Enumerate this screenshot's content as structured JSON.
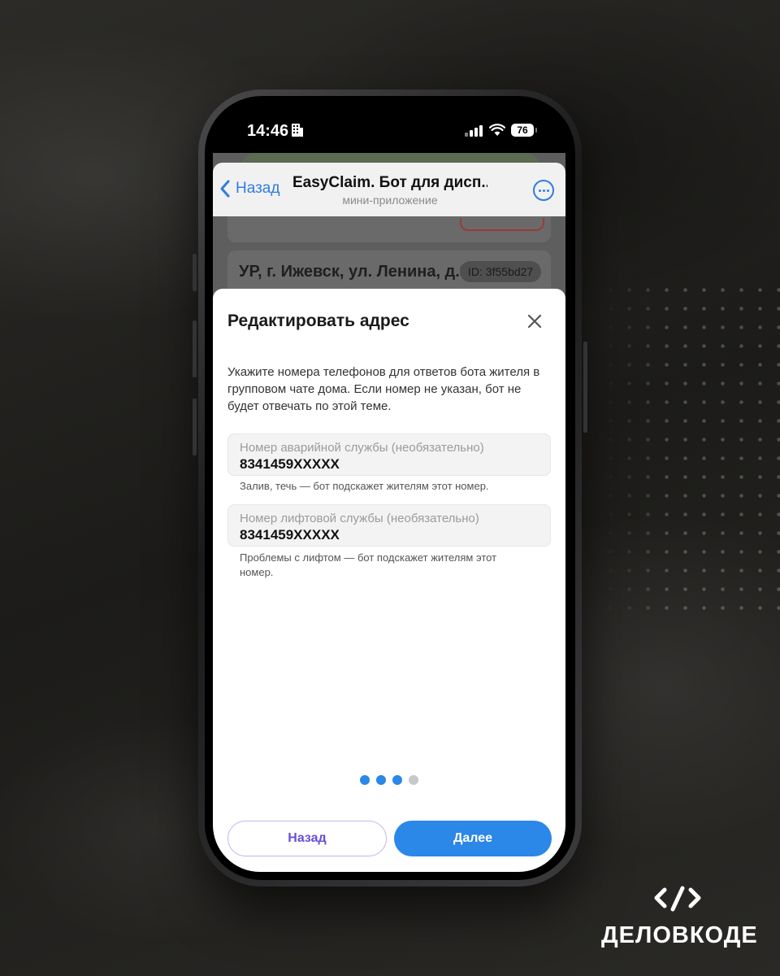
{
  "status_bar": {
    "time": "14:46",
    "battery": "76"
  },
  "background_app": {
    "address": "УР, г. Ижевск, ул. Ленина, д.3",
    "id_badge": "ID: 3f55bd27"
  },
  "header": {
    "back_label": "Назад",
    "title": "EasyClaim. Бот для дисп...",
    "subtitle": "мини-приложение"
  },
  "modal": {
    "title": "Редактировать адрес",
    "description": "Укажите номера телефонов для ответов бота жителя в групповом чате дома. Если номер не указан, бот не будет отвечать по этой теме.",
    "fields": [
      {
        "label": "Номер аварийной службы (необязательно)",
        "value": "8341459XXXXX",
        "hint": "Залив, течь — бот подскажет жителям этот номер."
      },
      {
        "label": "Номер лифтовой службы (необязательно)",
        "value": "8341459XXXXX",
        "hint": "Проблемы с лифтом — бот подскажет жителям этот номер."
      }
    ],
    "pager": {
      "total": 4,
      "current": 3,
      "active_color": "#2b87e8",
      "inactive_color": "#c7c7cc"
    },
    "buttons": {
      "back": "Назад",
      "next": "Далее"
    }
  },
  "brand": {
    "name": "ДЕЛОВКОДЕ"
  },
  "colors": {
    "accent_blue": "#2b87e8",
    "link_blue": "#2f7de1",
    "back_button_text": "#6a4fd6"
  }
}
